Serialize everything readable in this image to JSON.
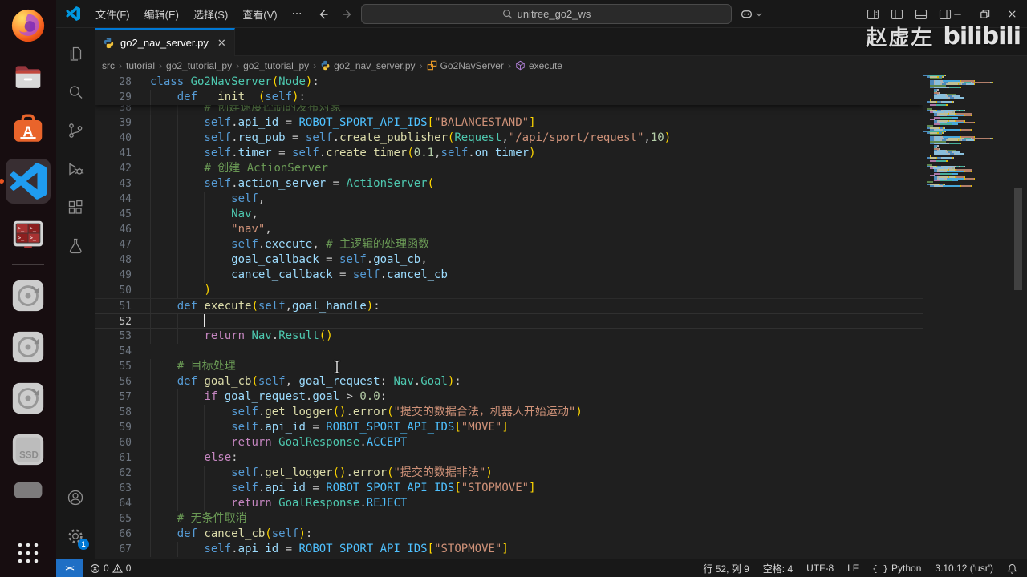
{
  "titlebar": {
    "menus": [
      "文件(F)",
      "编辑(E)",
      "选择(S)",
      "查看(V)",
      "⋯"
    ],
    "search_value": "unitree_go2_ws"
  },
  "watermark": {
    "author": "赵虚左",
    "brand": "bilibili"
  },
  "dock": {
    "items": [
      {
        "id": "firefox",
        "label": "Firefox"
      },
      {
        "id": "files",
        "label": "Files"
      },
      {
        "id": "ubuntu-software",
        "label": "Ubuntu Software"
      },
      {
        "id": "vscode",
        "label": "Visual Studio Code",
        "active": true
      },
      {
        "id": "terminator",
        "label": "Terminator"
      },
      {
        "id": "sep"
      },
      {
        "id": "disk",
        "label": "Disk"
      },
      {
        "id": "disk",
        "label": "Disk"
      },
      {
        "id": "disk",
        "label": "Disk"
      },
      {
        "id": "ssd",
        "label": "SSD"
      },
      {
        "id": "drive-partial",
        "label": "Drive"
      },
      {
        "id": "show-apps",
        "label": "Show Applications"
      }
    ]
  },
  "activity_bar": {
    "top": [
      "explorer",
      "search",
      "source-control",
      "run-debug",
      "extensions",
      "testing"
    ],
    "bottom": [
      "account",
      "settings"
    ],
    "settings_badge": "1"
  },
  "tabs": [
    {
      "label": "go2_nav_server.py",
      "active": true
    }
  ],
  "breadcrumbs": [
    {
      "label": "src"
    },
    {
      "label": "tutorial"
    },
    {
      "label": "go2_tutorial_py"
    },
    {
      "label": "go2_tutorial_py"
    },
    {
      "label": "go2_nav_server.py",
      "icon": "python"
    },
    {
      "label": "Go2NavServer",
      "icon": "class"
    },
    {
      "label": "execute",
      "icon": "method"
    }
  ],
  "editor": {
    "cursor": {
      "line": 52,
      "col": 9
    },
    "sticky_lines": [
      {
        "n": 28,
        "i": 0,
        "t": [
          [
            "kw",
            "class "
          ],
          [
            "typ",
            "Go2NavServer"
          ],
          [
            "b1",
            "("
          ],
          [
            "typ",
            "Node"
          ],
          [
            "b1",
            ")"
          ],
          [
            "pun",
            ":"
          ]
        ]
      },
      {
        "n": 29,
        "i": 4,
        "t": [
          [
            "kw",
            "def "
          ],
          [
            "fn",
            "__init__"
          ],
          [
            "b1",
            "("
          ],
          [
            "kw",
            "self"
          ],
          [
            "b1",
            ")"
          ],
          [
            "pun",
            ":"
          ]
        ]
      }
    ],
    "lines": [
      {
        "n": 38,
        "i": 8,
        "dim": true,
        "t": [
          [
            "com",
            "# 创建速度控制的发布对象"
          ]
        ]
      },
      {
        "n": 39,
        "i": 8,
        "t": [
          [
            "kw",
            "self"
          ],
          [
            "pun",
            "."
          ],
          [
            "var",
            "api_id"
          ],
          [
            "pun",
            " = "
          ],
          [
            "cst",
            "ROBOT_SPORT_API_IDS"
          ],
          [
            "b1",
            "["
          ],
          [
            "str",
            "\"BALANCESTAND\""
          ],
          [
            "b1",
            "]"
          ]
        ]
      },
      {
        "n": 40,
        "i": 8,
        "t": [
          [
            "kw",
            "self"
          ],
          [
            "pun",
            "."
          ],
          [
            "var",
            "req_pub"
          ],
          [
            "pun",
            " = "
          ],
          [
            "kw",
            "self"
          ],
          [
            "pun",
            "."
          ],
          [
            "fn",
            "create_publisher"
          ],
          [
            "b1",
            "("
          ],
          [
            "typ",
            "Request"
          ],
          [
            "pun",
            ","
          ],
          [
            "str",
            "\"/api/sport/request\""
          ],
          [
            "pun",
            ","
          ],
          [
            "tnum",
            "10"
          ],
          [
            "b1",
            ")"
          ]
        ]
      },
      {
        "n": 41,
        "i": 8,
        "t": [
          [
            "kw",
            "self"
          ],
          [
            "pun",
            "."
          ],
          [
            "var",
            "timer"
          ],
          [
            "pun",
            " = "
          ],
          [
            "kw",
            "self"
          ],
          [
            "pun",
            "."
          ],
          [
            "fn",
            "create_timer"
          ],
          [
            "b1",
            "("
          ],
          [
            "tnum",
            "0.1"
          ],
          [
            "pun",
            ","
          ],
          [
            "kw",
            "self"
          ],
          [
            "pun",
            "."
          ],
          [
            "var",
            "on_timer"
          ],
          [
            "b1",
            ")"
          ]
        ]
      },
      {
        "n": 42,
        "i": 8,
        "t": [
          [
            "com",
            "# 创建 ActionServer"
          ]
        ]
      },
      {
        "n": 43,
        "i": 8,
        "t": [
          [
            "kw",
            "self"
          ],
          [
            "pun",
            "."
          ],
          [
            "var",
            "action_server"
          ],
          [
            "pun",
            " = "
          ],
          [
            "typ",
            "ActionServer"
          ],
          [
            "b1",
            "("
          ]
        ]
      },
      {
        "n": 44,
        "i": 12,
        "t": [
          [
            "kw",
            "self"
          ],
          [
            "pun",
            ","
          ]
        ]
      },
      {
        "n": 45,
        "i": 12,
        "t": [
          [
            "typ",
            "Nav"
          ],
          [
            "pun",
            ","
          ]
        ]
      },
      {
        "n": 46,
        "i": 12,
        "t": [
          [
            "str",
            "\"nav\""
          ],
          [
            "pun",
            ","
          ]
        ]
      },
      {
        "n": 47,
        "i": 12,
        "t": [
          [
            "kw",
            "self"
          ],
          [
            "pun",
            "."
          ],
          [
            "var",
            "execute"
          ],
          [
            "pun",
            ", "
          ],
          [
            "com",
            "# 主逻辑的处理函数"
          ]
        ]
      },
      {
        "n": 48,
        "i": 12,
        "t": [
          [
            "var",
            "goal_callback"
          ],
          [
            "pun",
            " = "
          ],
          [
            "kw",
            "self"
          ],
          [
            "pun",
            "."
          ],
          [
            "var",
            "goal_cb"
          ],
          [
            "pun",
            ","
          ]
        ]
      },
      {
        "n": 49,
        "i": 12,
        "t": [
          [
            "var",
            "cancel_callback"
          ],
          [
            "pun",
            " = "
          ],
          [
            "kw",
            "self"
          ],
          [
            "pun",
            "."
          ],
          [
            "var",
            "cancel_cb"
          ]
        ]
      },
      {
        "n": 50,
        "i": 8,
        "t": [
          [
            "b1",
            ")"
          ]
        ]
      },
      {
        "n": 51,
        "i": 4,
        "pre": true,
        "t": [
          [
            "kw",
            "def "
          ],
          [
            "fn",
            "execute"
          ],
          [
            "b1",
            "("
          ],
          [
            "kw",
            "self"
          ],
          [
            "pun",
            ","
          ],
          [
            "var",
            "goal_handle"
          ],
          [
            "b1",
            ")"
          ],
          [
            "pun",
            ":"
          ]
        ]
      },
      {
        "n": 52,
        "i": 8,
        "cur": true,
        "t": []
      },
      {
        "n": 53,
        "i": 8,
        "t": [
          [
            "ctl",
            "return "
          ],
          [
            "typ",
            "Nav"
          ],
          [
            "pun",
            "."
          ],
          [
            "typ",
            "Result"
          ],
          [
            "b1",
            "()"
          ]
        ]
      },
      {
        "n": 54,
        "i": 0,
        "t": []
      },
      {
        "n": 55,
        "i": 4,
        "t": [
          [
            "com",
            "# 目标处理"
          ]
        ]
      },
      {
        "n": 56,
        "i": 4,
        "t": [
          [
            "kw",
            "def "
          ],
          [
            "fn",
            "goal_cb"
          ],
          [
            "b1",
            "("
          ],
          [
            "kw",
            "self"
          ],
          [
            "pun",
            ", "
          ],
          [
            "var",
            "goal_request"
          ],
          [
            "pun",
            ": "
          ],
          [
            "typ",
            "Nav"
          ],
          [
            "pun",
            "."
          ],
          [
            "typ",
            "Goal"
          ],
          [
            "b1",
            ")"
          ],
          [
            "pun",
            ":"
          ]
        ]
      },
      {
        "n": 57,
        "i": 8,
        "t": [
          [
            "ctl",
            "if "
          ],
          [
            "var",
            "goal_request"
          ],
          [
            "pun",
            "."
          ],
          [
            "var",
            "goal"
          ],
          [
            "pun",
            " > "
          ],
          [
            "tnum",
            "0.0"
          ],
          [
            "pun",
            ":"
          ]
        ]
      },
      {
        "n": 58,
        "i": 12,
        "t": [
          [
            "kw",
            "self"
          ],
          [
            "pun",
            "."
          ],
          [
            "fn",
            "get_logger"
          ],
          [
            "b1",
            "()"
          ],
          [
            "pun",
            "."
          ],
          [
            "fn",
            "error"
          ],
          [
            "b1",
            "("
          ],
          [
            "str",
            "\"提交的数据合法，机器人开始运动\""
          ],
          [
            "b1",
            ")"
          ]
        ]
      },
      {
        "n": 59,
        "i": 12,
        "t": [
          [
            "kw",
            "self"
          ],
          [
            "pun",
            "."
          ],
          [
            "var",
            "api_id"
          ],
          [
            "pun",
            " = "
          ],
          [
            "cst",
            "ROBOT_SPORT_API_IDS"
          ],
          [
            "b1",
            "["
          ],
          [
            "str",
            "\"MOVE\""
          ],
          [
            "b1",
            "]"
          ]
        ]
      },
      {
        "n": 60,
        "i": 12,
        "t": [
          [
            "ctl",
            "return "
          ],
          [
            "typ",
            "GoalResponse"
          ],
          [
            "pun",
            "."
          ],
          [
            "cst",
            "ACCEPT"
          ]
        ]
      },
      {
        "n": 61,
        "i": 8,
        "t": [
          [
            "ctl",
            "else"
          ],
          [
            "pun",
            ":"
          ]
        ]
      },
      {
        "n": 62,
        "i": 12,
        "t": [
          [
            "kw",
            "self"
          ],
          [
            "pun",
            "."
          ],
          [
            "fn",
            "get_logger"
          ],
          [
            "b1",
            "()"
          ],
          [
            "pun",
            "."
          ],
          [
            "fn",
            "error"
          ],
          [
            "b1",
            "("
          ],
          [
            "str",
            "\"提交的数据非法\""
          ],
          [
            "b1",
            ")"
          ]
        ]
      },
      {
        "n": 63,
        "i": 12,
        "t": [
          [
            "kw",
            "self"
          ],
          [
            "pun",
            "."
          ],
          [
            "var",
            "api_id"
          ],
          [
            "pun",
            " = "
          ],
          [
            "cst",
            "ROBOT_SPORT_API_IDS"
          ],
          [
            "b1",
            "["
          ],
          [
            "str",
            "\"STOPMOVE\""
          ],
          [
            "b1",
            "]"
          ]
        ]
      },
      {
        "n": 64,
        "i": 12,
        "t": [
          [
            "ctl",
            "return "
          ],
          [
            "typ",
            "GoalResponse"
          ],
          [
            "pun",
            "."
          ],
          [
            "cst",
            "REJECT"
          ]
        ]
      },
      {
        "n": 65,
        "i": 4,
        "t": [
          [
            "com",
            "# 无条件取消"
          ]
        ]
      },
      {
        "n": 66,
        "i": 4,
        "t": [
          [
            "kw",
            "def "
          ],
          [
            "fn",
            "cancel_cb"
          ],
          [
            "b1",
            "("
          ],
          [
            "kw",
            "self"
          ],
          [
            "b1",
            ")"
          ],
          [
            "pun",
            ":"
          ]
        ]
      },
      {
        "n": 67,
        "i": 8,
        "t": [
          [
            "kw",
            "self"
          ],
          [
            "pun",
            "."
          ],
          [
            "var",
            "api_id"
          ],
          [
            "pun",
            " = "
          ],
          [
            "cst",
            "ROBOT_SPORT_API_IDS"
          ],
          [
            "b1",
            "["
          ],
          [
            "str",
            "\"STOPMOVE\""
          ],
          [
            "b1",
            "]"
          ]
        ]
      }
    ]
  },
  "status_bar": {
    "remote": "><",
    "problems": {
      "errors": "0",
      "warnings": "0"
    },
    "right": [
      {
        "label": "行 52, 列 9"
      },
      {
        "label": "空格: 4"
      },
      {
        "label": "UTF-8"
      },
      {
        "label": "LF"
      },
      {
        "label": "Python",
        "icon": "braces"
      },
      {
        "label": "3.10.12 ('usr')"
      },
      {
        "label": "",
        "icon": "bell"
      }
    ]
  },
  "colors": {
    "accent": "#0078d4",
    "remote_bg": "#1f6fc5",
    "editor_bg": "#1f1f1f",
    "chrome_bg": "#181818",
    "dock_bg": "#170d10",
    "keyword": "#569cd6",
    "control": "#c586c0",
    "type": "#4ec9b0",
    "function": "#dcdcaa",
    "constant": "#4fc1ff",
    "string": "#ce9178",
    "number": "#b5cea8",
    "comment": "#6a9955",
    "variable": "#9cdcfe",
    "bracket": "#ffd700"
  }
}
